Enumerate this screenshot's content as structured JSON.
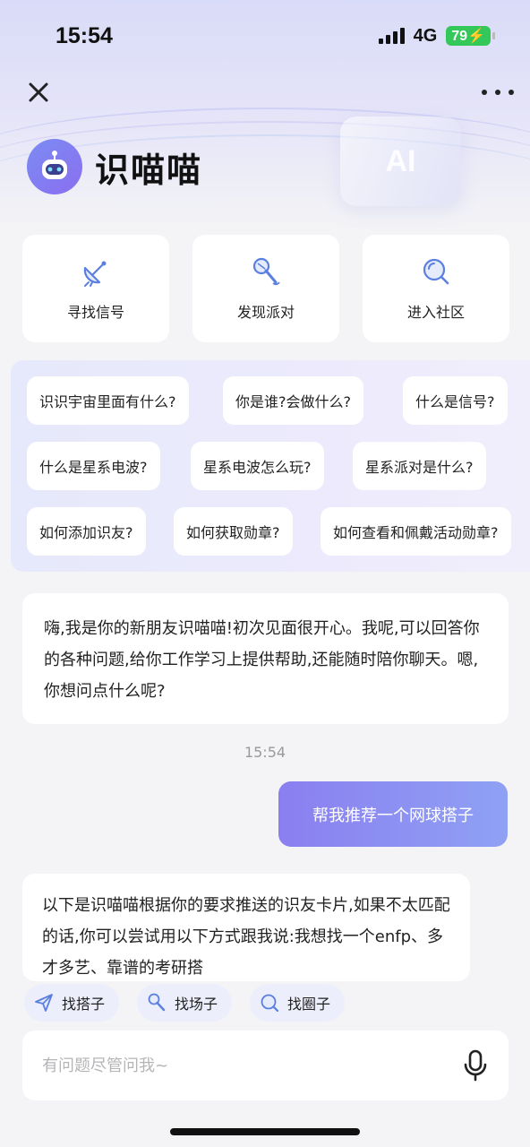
{
  "status_bar": {
    "time": "15:54",
    "network": "4G",
    "battery": "79"
  },
  "nav": {
    "close_icon": "close-icon",
    "more_icon": "more-icon"
  },
  "brand": {
    "title": "识喵喵",
    "badge": "AI"
  },
  "quick_actions": [
    {
      "label": "寻找信号",
      "icon": "satellite-dish-icon"
    },
    {
      "label": "发现派对",
      "icon": "microphone-icon"
    },
    {
      "label": "进入社区",
      "icon": "search-icon"
    }
  ],
  "suggestions": {
    "row1": [
      "识识宇宙里面有什么?",
      "你是谁?会做什么?",
      "什么是信号?"
    ],
    "row2": [
      "什么是星系电波?",
      "星系电波怎么玩?",
      "星系派对是什么?"
    ],
    "row3": [
      "如何添加识友?",
      "如何获取勋章?",
      "如何查看和佩戴活动勋章?"
    ]
  },
  "chat": {
    "greeting": "嗨,我是你的新朋友识喵喵!初次见面很开心。我呢,可以回答你的各种问题,给你工作学习上提供帮助,还能随时陪你聊天。嗯,你想问点什么呢?",
    "timestamp": "15:54",
    "user_message": "帮我推荐一个网球搭子",
    "reply": "以下是识喵喵根据你的要求推送的识友卡片,如果不太匹配的话,你可以尝试用以下方式跟我说:我想找一个enfp、多才多艺、靠谱的考研搭"
  },
  "shortcuts": [
    {
      "label": "找搭子",
      "icon": "send-icon"
    },
    {
      "label": "找场子",
      "icon": "mic-icon"
    },
    {
      "label": "找圈子",
      "icon": "search-icon"
    }
  ],
  "input": {
    "placeholder": "有问题尽管问我~",
    "value": ""
  },
  "colors": {
    "accent": "#8a7ff0",
    "accent2": "#8fa1f4",
    "icon_blue": "#5b7fe0",
    "background": "#f4f4f6"
  }
}
